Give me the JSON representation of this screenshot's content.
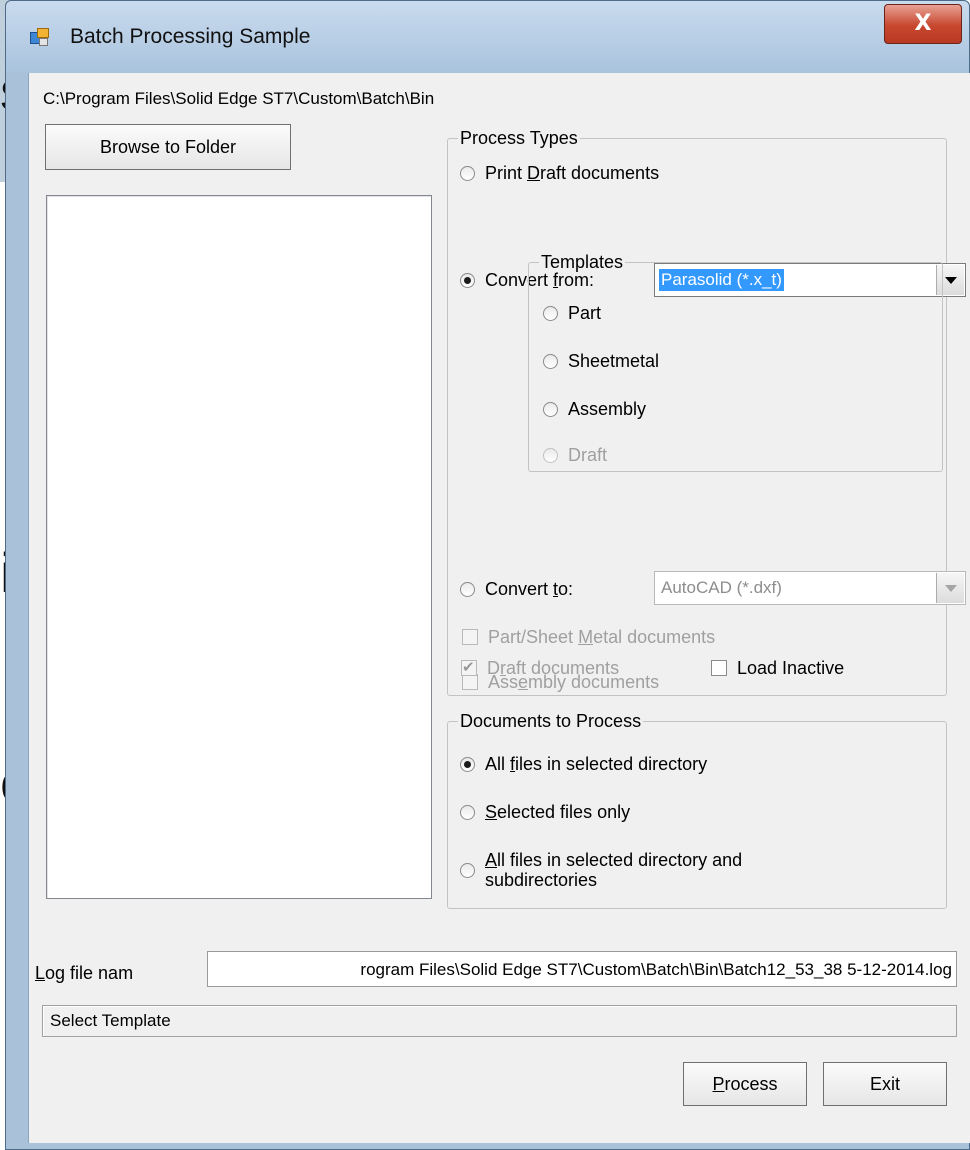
{
  "background": {
    "letters": [
      "s",
      "i",
      "o"
    ]
  },
  "window": {
    "title": "Batch Processing Sample",
    "app_icon": "forms-app-icon",
    "close_glyph": "X"
  },
  "folder": {
    "path": "C:\\Program Files\\Solid Edge ST7\\Custom\\Batch\\Bin",
    "browse_label": "Browse to Folder"
  },
  "process_types": {
    "legend": "Process Types",
    "print_draft": {
      "pre": "Print ",
      "u": "D",
      "post": "raft documents",
      "checked": false
    },
    "convert_from": {
      "pre": "Convert ",
      "u": "f",
      "post": "rom:",
      "checked": true,
      "value": "Parasolid (*.x_t)"
    },
    "templates": {
      "legend": "Templates",
      "items": [
        {
          "label": "Part",
          "disabled": false
        },
        {
          "label": "Sheetmetal",
          "disabled": false
        },
        {
          "label": "Assembly",
          "disabled": false
        },
        {
          "label": "Draft",
          "disabled": true
        }
      ]
    },
    "convert_to": {
      "pre": "Convert ",
      "u": "t",
      "post": "o:",
      "checked": false,
      "value": "AutoCAD (*.dxf)"
    },
    "part_sheet": {
      "pre": "Part/Sheet ",
      "u": "M",
      "post": "etal documents",
      "checked": false
    },
    "assembly_docs": {
      "pre": "Ass",
      "u": "e",
      "post": "mbly documents",
      "checked": false
    },
    "draft_docs": {
      "pre": "D",
      "u": "r",
      "post": "aft documents",
      "checked": true
    },
    "load_inactive": {
      "label": "Load Inactive",
      "checked": false
    }
  },
  "documents_to_process": {
    "legend": "Documents to Process",
    "all_files": {
      "pre": "All ",
      "u": "f",
      "post": "iles in selected directory",
      "checked": true
    },
    "selected_only": {
      "pre": "",
      "u": "S",
      "post": "elected files only",
      "checked": false
    },
    "all_sub": {
      "u": "A",
      "line1": "ll files in selected directory and",
      "line2": "subdirectories",
      "checked": false
    }
  },
  "log": {
    "label_u": "L",
    "label_rest": "og file nam",
    "value": "rogram Files\\Solid Edge ST7\\Custom\\Batch\\Bin\\Batch12_53_38 5-12-2014.log"
  },
  "status": "Select Template",
  "buttons": {
    "process_u": "P",
    "process_rest": "rocess",
    "exit": "Exit"
  }
}
